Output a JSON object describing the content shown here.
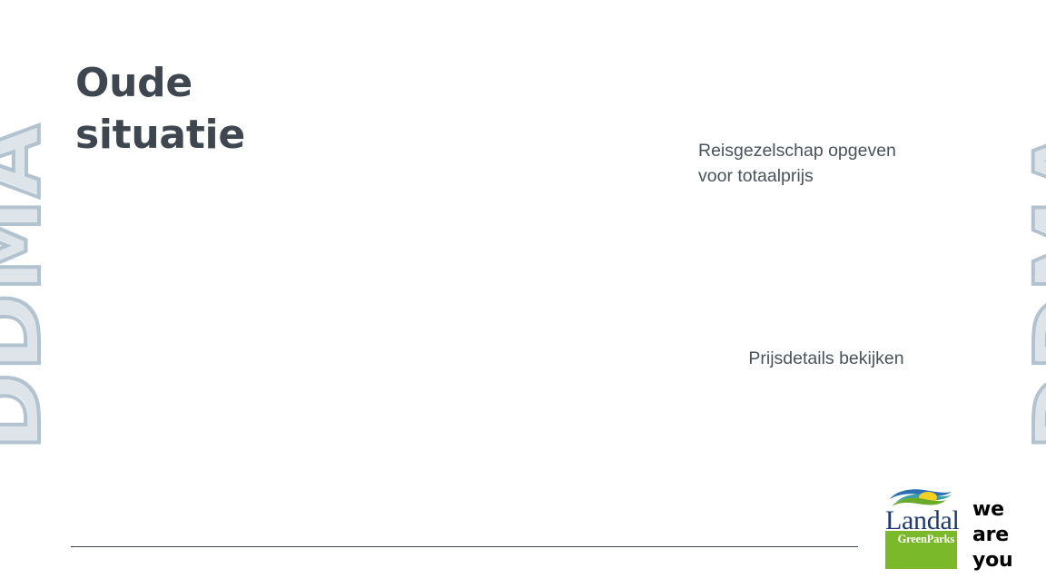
{
  "slide": {
    "title": "Oude\nsituatie",
    "title_line1": "Oude",
    "title_line2": "situatie",
    "background_color": "#ffffff",
    "title_color": "#3e464f",
    "body_color": "#4a535b"
  },
  "watermark": {
    "text": "DDMA",
    "stroke_color": "#b2c2cf",
    "shadow_color": "#dde5eb",
    "rotation_deg": -90
  },
  "callouts": [
    {
      "name": "reisgezelschap-callout",
      "text": "Reisgezelschap opgeven voor totaalprijs",
      "line1": "Reisgezelschap opgeven",
      "line2": "voor totaalprijs"
    },
    {
      "name": "prijsdetails-callout",
      "text": "Prijsdetails bekijken"
    }
  ],
  "divider": {
    "color": "#3c4248"
  },
  "logo": {
    "brand": "Landal",
    "sub_brand": "GreenParks",
    "green_color": "#7ab929",
    "wordmark_color": "#1f3a72",
    "swoosh": {
      "blue": "#2d6fb5",
      "green": "#6bab2a",
      "yellow": "#f2d024",
      "teal": "#39a0a8"
    }
  },
  "tagline": {
    "line1": "we",
    "line2": "are",
    "line3": "you",
    "color": "#000000"
  }
}
